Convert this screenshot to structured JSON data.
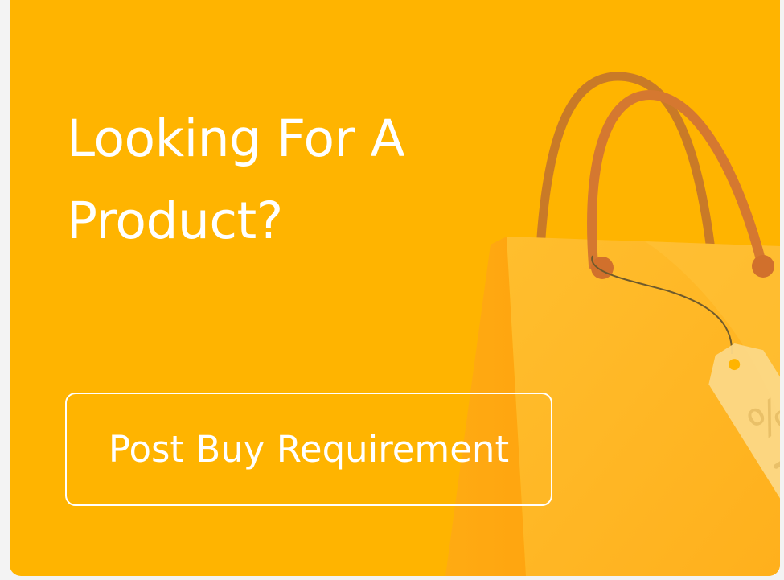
{
  "promo": {
    "heading_line1": "Looking For A",
    "heading_line2": "Product?",
    "cta_label": "Post Buy Requirement",
    "tag_symbol": "%"
  },
  "colors": {
    "background": "#ffb400",
    "text": "#ffffff",
    "bag_body": "#ffb91f",
    "bag_handle": "#d2772a",
    "price_tag": "#fcd886"
  }
}
